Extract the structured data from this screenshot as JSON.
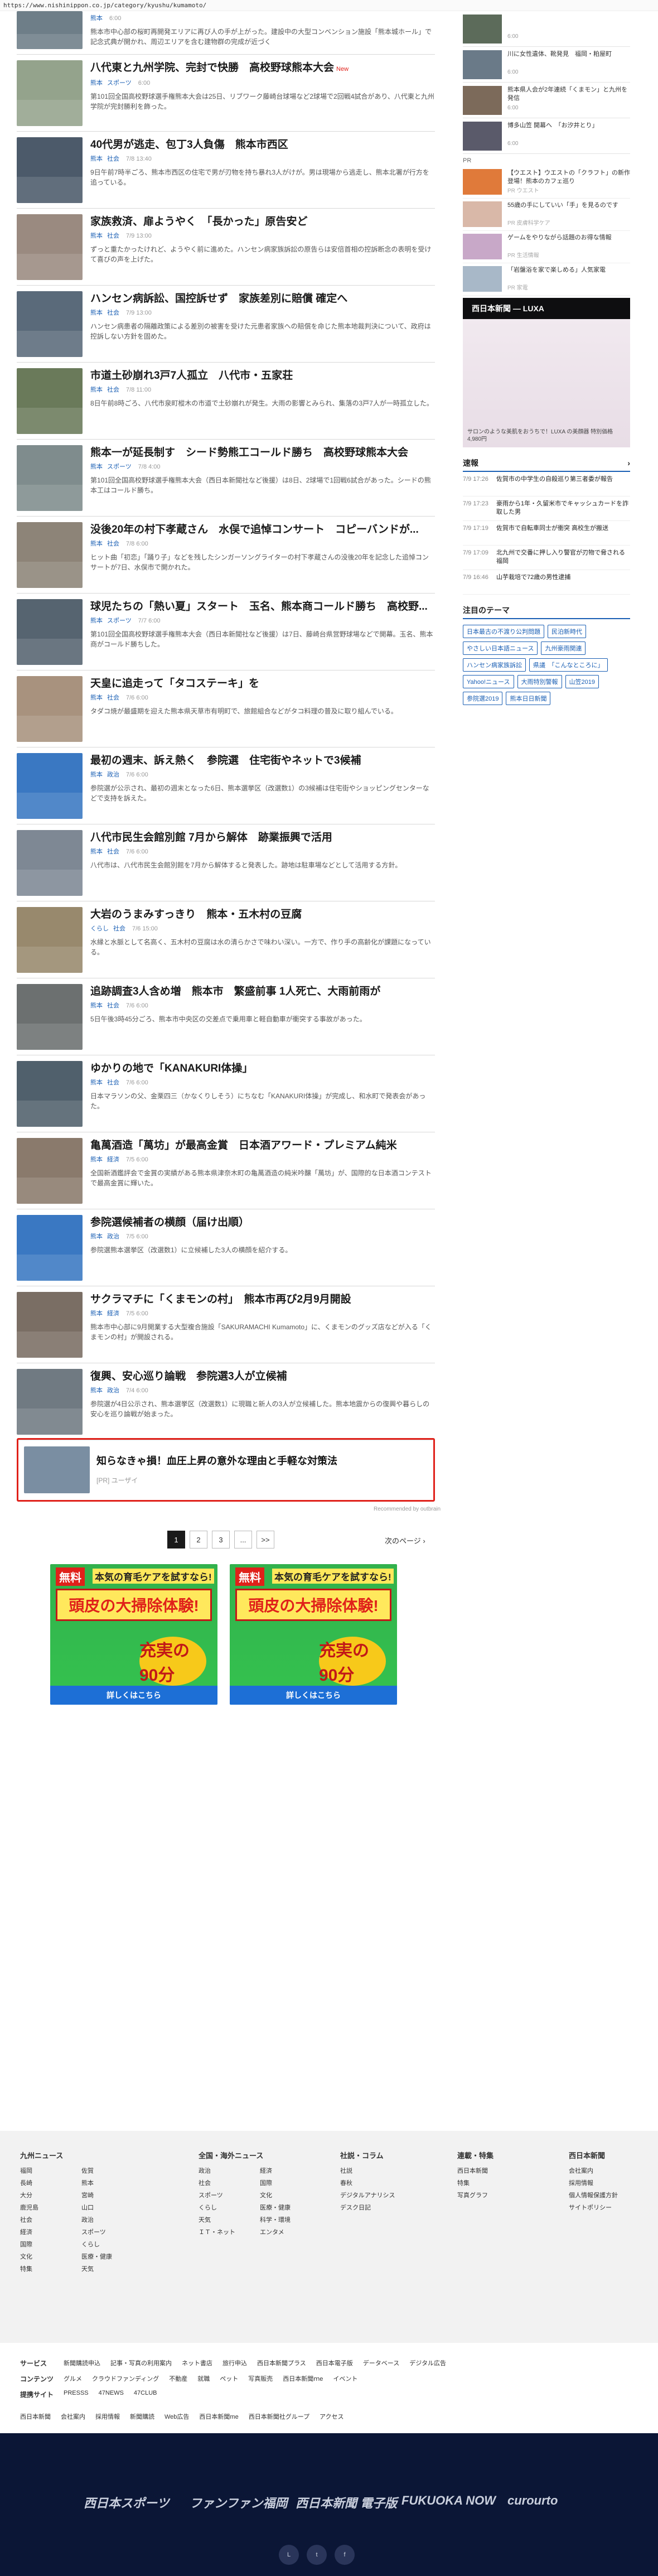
{
  "url": "https://www.nishinippon.co.jp/category/kyushu/kumamoto/",
  "articles": [
    {
      "title": "",
      "cat": "熊本",
      "cat2": "",
      "time": "6:00",
      "new": "",
      "desc": "熊本市中心部の桜町再開発エリアに再び人の手が上がった。建設中の大型コンベンション施設「熊本城ホール」で記念式典が開かれ、周辺エリアを含む建物群の完成が近づく"
    },
    {
      "title": "八代東と九州学院、完封で快勝　高校野球熊本大会",
      "cat": "熊本",
      "cat2": "スポーツ",
      "time": "6:00",
      "new": "New",
      "desc": "第101回全国高校野球選手権熊本大会は25日、リブワーク藤崎台球場など2球場で2回戦4試合があり、八代東と九州学院が完封勝利を飾った。"
    },
    {
      "title": "40代男が逃走、包丁3人負傷　熊本市西区",
      "cat": "熊本",
      "cat2": "社会",
      "time": "7/8 13:40",
      "new": "",
      "desc": "9日午前7時半ごろ、熊本市西区の住宅で男が刃物を持ち暴れ3人がけが。男は現場から逃走し、熊本北署が行方を追っている。"
    },
    {
      "title": "家族救済、扉ようやく　「長かった」原告安ど",
      "cat": "熊本",
      "cat2": "社会",
      "time": "7/9 13:00",
      "new": "",
      "desc": "ずっと重たかったけれど、ようやく前に進めた。ハンセン病家族訴訟の原告らは安倍首相の控訴断念の表明を受けて喜びの声を上げた。"
    },
    {
      "title": "ハンセン病訴訟、国控訴せず　家族差別に賠償 確定へ",
      "cat": "熊本",
      "cat2": "社会",
      "time": "7/9 13:00",
      "new": "",
      "desc": "ハンセン病患者の隔離政策による差別の被害を受けた元患者家族への賠償を命じた熊本地裁判決について、政府は控訴しない方針を固めた。"
    },
    {
      "title": "市道土砂崩れ3戸7人孤立　八代市・五家荘",
      "cat": "熊本",
      "cat2": "社会",
      "time": "7/8 11:00",
      "new": "",
      "desc": "8日午前8時ごろ、八代市泉町樅木の市道で土砂崩れが発生。大雨の影響とみられ、集落の3戸7人が一時孤立した。"
    },
    {
      "title": "熊本一が延長制す　シード勢熊工コールド勝ち　高校野球熊本大会",
      "cat": "熊本",
      "cat2": "スポーツ",
      "time": "7/8 4:00",
      "new": "",
      "desc": "第101回全国高校野球選手権熊本大会（西日本新聞社など後援）は8日、2球場で1回戦6試合があった。シードの熊本工はコールド勝ち。"
    },
    {
      "title": "没後20年の村下孝蔵さん　水俣で追悼コンサート　コピーバンドが...",
      "cat": "熊本",
      "cat2": "社会",
      "time": "7/8 6:00",
      "new": "",
      "desc": "ヒット曲「初恋」「踊り子」などを残したシンガーソングライターの村下孝蔵さんの没後20年を記念した追悼コンサートが7日、水俣市で開かれた。"
    },
    {
      "title": "球児たちの「熱い夏」スタート　玉名、熊本商コールド勝ち　高校野...",
      "cat": "熊本",
      "cat2": "スポーツ",
      "time": "7/7 6:00",
      "new": "",
      "desc": "第101回全国高校野球選手権熊本大会（西日本新聞社など後援）は7日、藤崎台県営野球場などで開幕。玉名、熊本商がコールド勝ちした。"
    },
    {
      "title": "天皇に追走って「タコステーキ」を",
      "cat": "熊本",
      "cat2": "社会",
      "time": "7/6 6:00",
      "new": "",
      "desc": "タダコ焼が最盛期を迎えた熊本県天草市有明町で、旅館組合などがタコ料理の普及に取り組んでいる。"
    },
    {
      "title": "最初の週末、訴え熱く　参院選　住宅街やネットで3候補",
      "cat": "熊本",
      "cat2": "政治",
      "time": "7/6 6:00",
      "new": "",
      "desc": "参院選が公示され、最初の週末となった6日、熊本選挙区（改選数1）の3候補は住宅街やショッピングセンターなどで支持を訴えた。"
    },
    {
      "title": "八代市民生会館別館 7月から解体　跡業振興で活用",
      "cat": "熊本",
      "cat2": "社会",
      "time": "7/6 6:00",
      "new": "",
      "desc": "八代市は、八代市民生会館別館を7月から解体すると発表した。跡地は駐車場などとして活用する方針。"
    },
    {
      "title": "大岩のうまみすっきり　熊本・五木村の豆腐",
      "cat": "くらし",
      "cat2": "社会",
      "time": "7/6 15:00",
      "new": "",
      "desc": "水縁と水脈として名高く、五木村の豆腐は水の清らかさで味わい深い。一方で、作り手の高齢化が課題になっている。"
    },
    {
      "title": "追跡調査3人含め増　熊本市　繁盛前事 1人死亡、大雨前雨が",
      "cat": "熊本",
      "cat2": "社会",
      "time": "7/6 6:00",
      "new": "",
      "desc": "5日午後3時45分ごろ、熊本市中央区の交差点で乗用車と軽自動車が衝突する事故があった。"
    },
    {
      "title": "ゆかりの地で「KANAKURI体操」",
      "cat": "熊本",
      "cat2": "社会",
      "time": "7/6 6:00",
      "new": "",
      "desc": "日本マラソンの父、金栗四三（かなくりしそう）にちなむ「KANAKURI体操」が完成し、和水町で発表会があった。"
    },
    {
      "title": "亀萬酒造「萬坊」が最高金賞　日本酒アワード・プレミアム純米",
      "cat": "熊本",
      "cat2": "経済",
      "time": "7/5 6:00",
      "new": "",
      "desc": "全国新酒鑑評会で金賞の実績がある熊本県津奈木町の亀萬酒造の純米吟醸「萬坊」が、国際的な日本酒コンテストで最高金賞に輝いた。"
    },
    {
      "title": "参院選候補者の横顔（届け出順）",
      "cat": "熊本",
      "cat2": "政治",
      "time": "7/5 6:00",
      "new": "",
      "desc": "参院選熊本選挙区（改選数1）に立候補した3人の横顔を紹介する。"
    },
    {
      "title": "サクラマチに「くまモンの村」　熊本市再び2月9月開設",
      "cat": "熊本",
      "cat2": "経済",
      "time": "7/5 6:00",
      "new": "",
      "desc": "熊本市中心部に9月開業する大型複合施設「SAKURAMACHI Kumamoto」に、くまモンのグッズ店などが入る「くまモンの村」が開設される。"
    },
    {
      "title": "復興、安心巡り論戦　参院選3人が立候補",
      "cat": "熊本",
      "cat2": "政治",
      "time": "7/4 6:00",
      "new": "",
      "desc": "参院選が4日公示され、熊本選挙区（改選数1）に現職と新人の3人が立候補した。熊本地震からの復興や暮らしの安心を巡り論戦が始まった。"
    }
  ],
  "rec": {
    "title": "知らなきゃ損！血圧上昇の意外な理由と手軽な対策法",
    "sponsor": "[PR] ユーザイ",
    "by": "Recommended by  outbrain"
  },
  "pager": {
    "pages": [
      "1",
      "2",
      "3",
      "...",
      ">>"
    ],
    "next": "次のページ"
  },
  "ads": [
    {
      "free": "無料",
      "l1": "本気の育毛ケアを試すなら!",
      "l2": "頭皮の大掃除体験!",
      "l3": "充実の90分",
      "cta": "詳しくはこちら"
    },
    {
      "free": "無料",
      "l1": "本気の育毛ケアを試すなら!",
      "l2": "頭皮の大掃除体験!",
      "l3": "充実の90分",
      "cta": "詳しくはこちら"
    }
  ],
  "side": {
    "items": [
      {
        "t": "",
        "d": "6:00"
      },
      {
        "t": "川に女性遺体、靴発見　福岡・粕屋町",
        "d": "6:00"
      },
      {
        "t": "熊本県人会が2年連続「くまモン」と九州を発信",
        "d": "6:00"
      },
      {
        "t": "博多山笠 開幕へ　「お汐井とり」",
        "d": "6:00"
      }
    ],
    "pr_label": "PR",
    "pr": [
      {
        "t": "【ウエスト】ウエストの「クラフト」の新作登場！熊本のカフェ巡り",
        "d": "PR ウエスト"
      },
      {
        "t": "55歳の手にしていい「手」を見るのです",
        "d": "PR 皮膚科学ケア"
      },
      {
        "t": "ゲームをやりながら話題のお得な情報",
        "d": "PR 生活情報"
      },
      {
        "t": "「岩盤浴を家で楽しめる」人気家電",
        "d": "PR 家電"
      }
    ],
    "adhead": "西日本新聞 ― LUXA",
    "adtext": "サロンのような美肌をおうちで！LUXA の美顔器 特別価格 4,980円",
    "breaking_title": "速報",
    "breaking": [
      {
        "tm": "7/9 17:26",
        "t": "佐賀市の中学生の自殺巡り第三者委が報告"
      },
      {
        "tm": "7/9 17:23",
        "t": "豪雨から1年・久留米市でキャッシュカードを詐取した男"
      },
      {
        "tm": "7/9 17:19",
        "t": "佐賀市で自転車同士が衝突 高校生が搬送"
      },
      {
        "tm": "7/9 17:09",
        "t": "北九州で交番に押し入り警官が刃物で脅される　福岡"
      },
      {
        "tm": "7/9 16:46",
        "t": "山芋栽培で72歳の男性逮捕"
      }
    ],
    "theme_title": "注目のテーマ",
    "tags": [
      "日本最古の不渡り公判問題",
      "民泊新時代",
      "やさしい日本語ニュース",
      "九州豪雨関連",
      "ハンセン病家族訴訟",
      "県議　「こんなところに」",
      "Yahoo!ニュース",
      "大雨特別警報",
      "山笠2019",
      "参院選2019",
      "熊本日日新聞"
    ]
  },
  "footer": {
    "c1": {
      "h": "九州ニュース",
      "items": [
        "福岡",
        "佐賀",
        "長崎",
        "熊本",
        "大分",
        "宮崎",
        "鹿児島",
        "山口",
        "社会",
        "政治",
        "経済",
        "スポーツ",
        "国際",
        "くらし",
        "文化",
        "医療・健康",
        "特集",
        "天気"
      ]
    },
    "c2": {
      "h": "全国・海外ニュース",
      "items": [
        "政治",
        "経済",
        "社会",
        "国際",
        "スポーツ",
        "文化",
        "くらし",
        "医療・健康",
        "天気",
        "科学・環境",
        "ＩＴ・ネット",
        "エンタメ"
      ]
    },
    "c3": {
      "h": "社説・コラム",
      "items": [
        "社説",
        "春秋",
        "デジタルアナリシス",
        "デスク日記"
      ]
    },
    "c4": {
      "h": "連載・特集",
      "items": [
        "西日本新聞",
        "特集",
        "写真グラフ"
      ]
    },
    "c5": {
      "h": "西日本新聞",
      "items": [
        "会社案内",
        "採用情報",
        "個人情報保護方針",
        "サイトポリシー"
      ]
    }
  },
  "links": [
    {
      "h": "サービス",
      "items": [
        "新聞購読申込",
        "記事・写真の利用案内",
        "ネット書店",
        "旅行申込",
        "西日本新聞プラス",
        "西日本電子版",
        "データベース",
        "デジタル広告"
      ]
    },
    {
      "h": "コンテンツ",
      "items": [
        "グルメ",
        "クラウドファンディング",
        "不動産",
        "就職",
        "ペット",
        "写真販売",
        "西日本新聞ｍe",
        "イベント"
      ]
    },
    {
      "h": "提携サイト",
      "items": [
        "PRESSS",
        "47NEWS",
        "47CLUB"
      ]
    }
  ],
  "bottom_links": [
    "西日本新聞",
    "会社案内",
    "採用情報",
    "新聞購読",
    "Web広告",
    "西日本新聞me",
    "西日本新聞社グループ",
    "アクセス"
  ],
  "logos": [
    "西日本スポーツ",
    "ファンファン福岡",
    "西日本新聞 電子版",
    "FUKUOKA NOW",
    "curourto"
  ]
}
